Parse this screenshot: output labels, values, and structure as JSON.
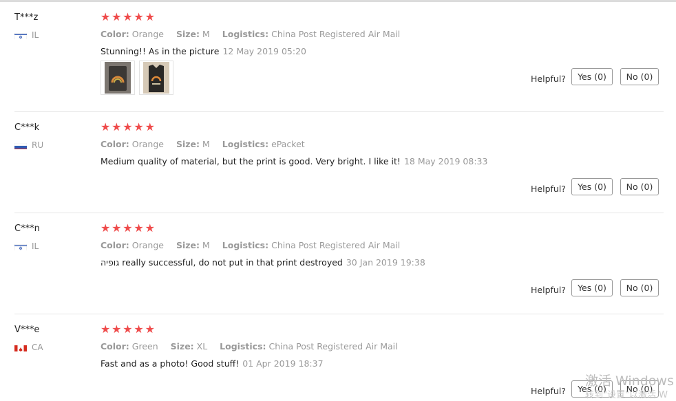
{
  "labels": {
    "color": "Color:",
    "size": "Size:",
    "logistics": "Logistics:",
    "helpful": "Helpful?"
  },
  "reviews": [
    {
      "user": "T***z",
      "country": "IL",
      "flag": "israel-flag-icon",
      "stars": 5,
      "color": "Orange",
      "size": "M",
      "logistics": "China Post Registered Air Mail",
      "text": "Stunning!! As in the picture",
      "date": "12 May 2019 05:20",
      "photos": [
        "review-photo-1",
        "review-photo-2"
      ],
      "yes": "Yes (0)",
      "no": "No (0)"
    },
    {
      "user": "C***k",
      "country": "RU",
      "flag": "russia-flag-icon",
      "stars": 5,
      "color": "Orange",
      "size": "M",
      "logistics": "ePacket",
      "text": "Medium quality of material, but the print is good. Very bright. I like it!",
      "date": "18 May 2019 08:33",
      "yes": "Yes (0)",
      "no": "No (0)"
    },
    {
      "user": "C***n",
      "country": "IL",
      "flag": "israel-flag-icon",
      "stars": 5,
      "color": "Orange",
      "size": "M",
      "logistics": "China Post Registered Air Mail",
      "text": "גופיה really successful, do not put in that print destroyed",
      "date": "30 Jan 2019 19:38",
      "yes": "Yes (0)",
      "no": "No (0)"
    },
    {
      "user": "V***e",
      "country": "CA",
      "flag": "canada-flag-icon",
      "stars": 5,
      "color": "Green",
      "size": "XL",
      "logistics": "China Post Registered Air Mail",
      "text": "Fast and as a photo! Good stuff!",
      "date": "01 Apr 2019 18:37",
      "yes": "Yes (0)",
      "no": "No (0)"
    }
  ],
  "watermark": {
    "line1": "激活 Windows",
    "line2": "转到\"设置\"以激活 W"
  },
  "colors": {
    "star": "#ef4b4b",
    "muted": "#999999",
    "divider": "#e6e6e6"
  }
}
